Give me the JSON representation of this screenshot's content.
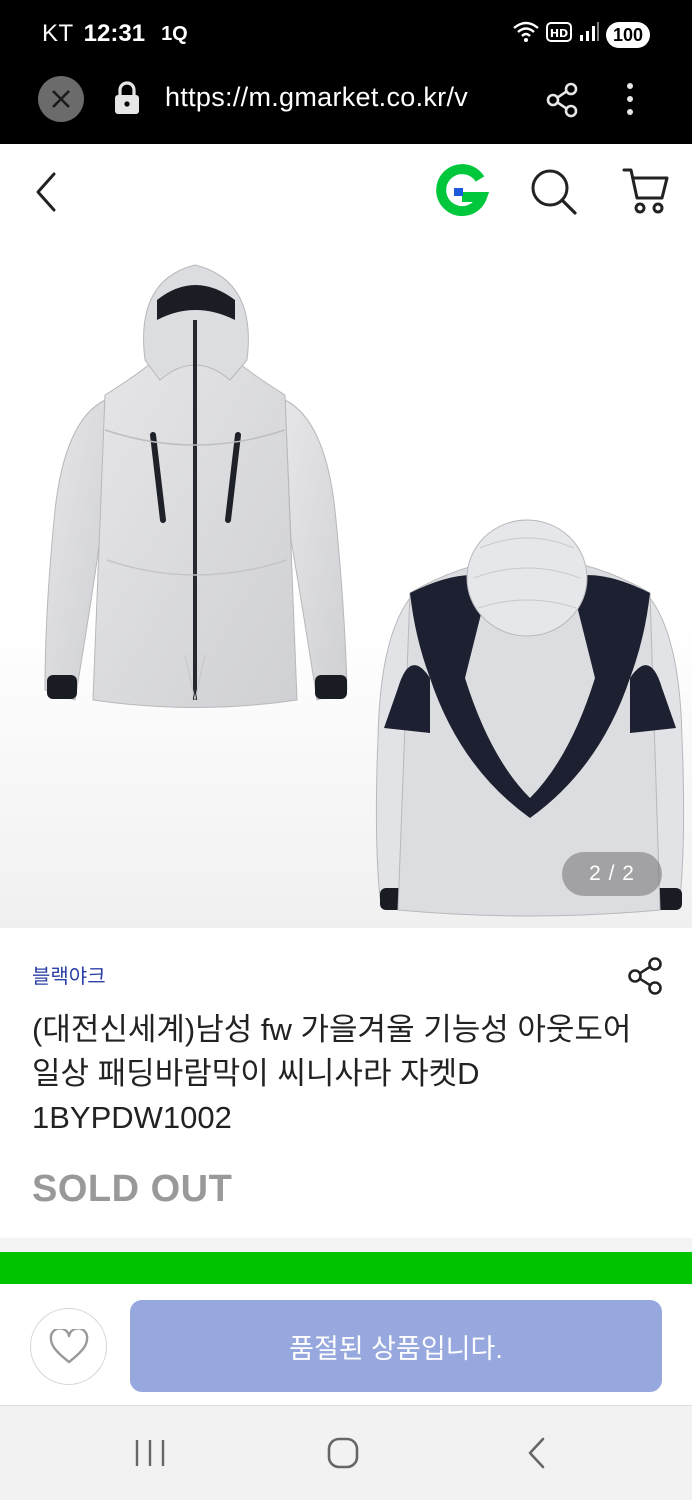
{
  "status_bar": {
    "carrier": "KT",
    "time": "12:31",
    "extra": "1Q",
    "battery": "100"
  },
  "browser": {
    "url": "https://m.gmarket.co.kr/v"
  },
  "gallery": {
    "page_indicator": "2 / 2"
  },
  "product": {
    "brand": "블랙야크",
    "title": "(대전신세계)남성 fw 가을겨울 기능성 아웃도어 일상 패딩바람막이 씨니사라 자켓D 1BYPDW1002",
    "status": "SOLD OUT"
  },
  "action_bar": {
    "buy_label": "품절된 상품입니다."
  },
  "colors": {
    "brand": "#2b3fa6",
    "accent_green": "#00c300",
    "button_disabled": "#96a8de"
  }
}
